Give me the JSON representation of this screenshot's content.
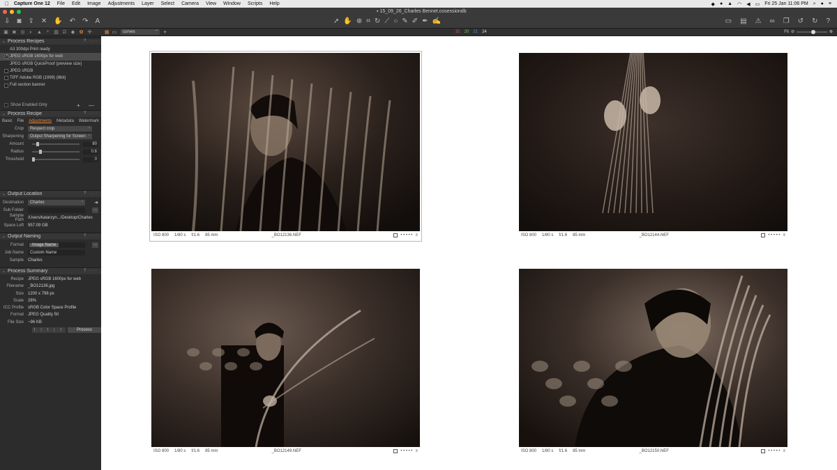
{
  "menubar": {
    "apple": "",
    "app_name": "Capture One 12",
    "items": [
      "File",
      "Edit",
      "Image",
      "Adjustments",
      "Layer",
      "Select",
      "Camera",
      "View",
      "Window",
      "Scripts",
      "Help"
    ],
    "datetime": "Fri 25 Jan  11:06 PM"
  },
  "window": {
    "title": "15_09_26_Charles Bennet.cosessiondb",
    "traffic_colors": [
      "#fe5f57",
      "#febc2e",
      "#28c840"
    ]
  },
  "viewer_bar": {
    "style_select": "curves",
    "counts": [
      {
        "value": "31",
        "color": "#e25a4d"
      },
      {
        "value": "20",
        "color": "#7cc35a"
      },
      {
        "value": "21",
        "color": "#5a8ee2"
      },
      {
        "value": "24",
        "color": "#dddddd"
      }
    ],
    "zoom_label": "Fit",
    "zoom_level": 0.55
  },
  "process_recipes": {
    "title": "Process Recipes",
    "header_actions": "? ···",
    "items": [
      {
        "label": "A3 300dpi Print ready",
        "checked": false,
        "show_checkbox": false
      },
      {
        "label": "JPEG sRGB 1600px for web",
        "checked": true,
        "show_checkbox": true
      },
      {
        "label": "JPEG sRGB QuickProof (preview size)",
        "checked": false,
        "show_checkbox": false
      },
      {
        "label": "JPEG sRGB",
        "checked": false,
        "show_checkbox": true
      },
      {
        "label": "TIFF Adobe RGB (1998) (8bit)",
        "checked": false,
        "show_checkbox": true
      },
      {
        "label": "Full section banner",
        "checked": false,
        "show_checkbox": true
      }
    ],
    "show_enabled_only": "Show Enabled Only",
    "plus_minus": "+ —"
  },
  "process_recipe": {
    "title": "Process Recipe",
    "header_actions": "? ···",
    "tabs": [
      "Basic",
      "File",
      "Adjustments",
      "Metadata",
      "Watermark"
    ],
    "active_tab": "Adjustments",
    "crop_label": "Crop",
    "crop_value": "Respect crop",
    "sharpening_label": "Sharpening",
    "sharpening_value": "Output Sharpening for Screen",
    "amount_label": "Amount",
    "amount_value": "80",
    "amount_level": 0.1,
    "radius_label": "Radius",
    "radius_value": "0.6",
    "radius_level": 0.15,
    "threshold_label": "Threshold",
    "threshold_value": "0",
    "threshold_level": 0.0
  },
  "output_location": {
    "title": "Output Location",
    "header_actions": "? ···",
    "destination_label": "Destination",
    "destination_value": "Charles",
    "subfolder_label": "Sub Folder",
    "subfolder_value": "",
    "dots": "...",
    "sample_path_label": "Sample Path",
    "sample_path_value": "/Users/katarzyn.../Desktop/Charles",
    "space_left_label": "Space Left",
    "space_left_value": "957.09 GB"
  },
  "output_naming": {
    "title": "Output Naming",
    "header_actions": "? ···",
    "format_label": "Format",
    "format_value": "Image Name",
    "dots": "...",
    "job_name_label": "Job Name",
    "job_name_value": "Custom Name",
    "sample_label": "Sample",
    "sample_value": "Charles"
  },
  "process_summary": {
    "title": "Process Summary",
    "header_actions": "? ···",
    "rows": [
      {
        "label": "Recipe",
        "value": "JPEG sRGB 1600px for web"
      },
      {
        "label": "Filename",
        "value": "_BO12136.jpg"
      },
      {
        "label": "Size",
        "value": "1200 x 798 px"
      },
      {
        "label": "Scale",
        "value": "28%"
      },
      {
        "label": "ICC Profile",
        "value": "sRGB Color Space Profile"
      },
      {
        "label": "Format",
        "value": "JPEG Quality 50"
      },
      {
        "label": "File Size",
        "value": "~96 KB"
      }
    ],
    "stepper": "1 | 1 | 1",
    "process_button": "Process"
  },
  "thumbnails": [
    {
      "iso": "ISO 800",
      "shutter": "1/80 s",
      "aperture": "f/1.6",
      "focal": "85 mm",
      "filename": "_BO12136.NEF",
      "rating_dots": "• • • • •",
      "selected": true,
      "variant": "a"
    },
    {
      "iso": "ISO 800",
      "shutter": "1/80 s",
      "aperture": "f/1.6",
      "focal": "85 mm",
      "filename": "_BO12144.NEF",
      "rating_dots": "• • • • •",
      "selected": false,
      "variant": "b"
    },
    {
      "iso": "ISO 800",
      "shutter": "1/80 s",
      "aperture": "f/1.6",
      "focal": "85 mm",
      "filename": "_BO12149.NEF",
      "rating_dots": "• • • • •",
      "selected": false,
      "variant": "c"
    },
    {
      "iso": "ISO 800",
      "shutter": "1/80 s",
      "aperture": "f/1.6",
      "focal": "85 mm",
      "filename": "_BO12150.NEF",
      "rating_dots": "• • • • •",
      "selected": false,
      "variant": "d"
    }
  ],
  "colors": {
    "accent": "#e8873a",
    "sidebar_bg": "#2c2c2c",
    "viewer_bg": "#ffffff"
  }
}
